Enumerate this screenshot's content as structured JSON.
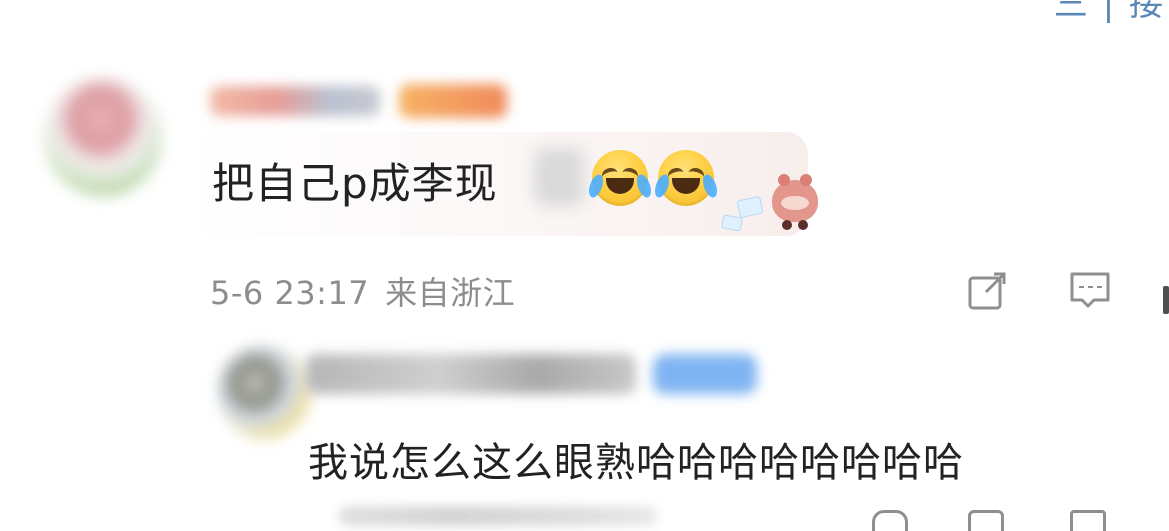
{
  "header": {
    "top_right_label": "三 | 接"
  },
  "comment": {
    "text_main": "把自己p成李现",
    "timestamp": "5-6 23:17",
    "origin": "来自浙江",
    "icons": {
      "share": "share-icon",
      "reply": "comment-icon",
      "emoji": "laughing-crying-emoji-icon"
    }
  },
  "reply": {
    "text": "我说怎么这么眼熟哈哈哈哈哈哈哈哈"
  },
  "colors": {
    "meta_gray": "#8d8d8d",
    "text_dark": "#222222",
    "accent_blue": "#5b86b8"
  }
}
